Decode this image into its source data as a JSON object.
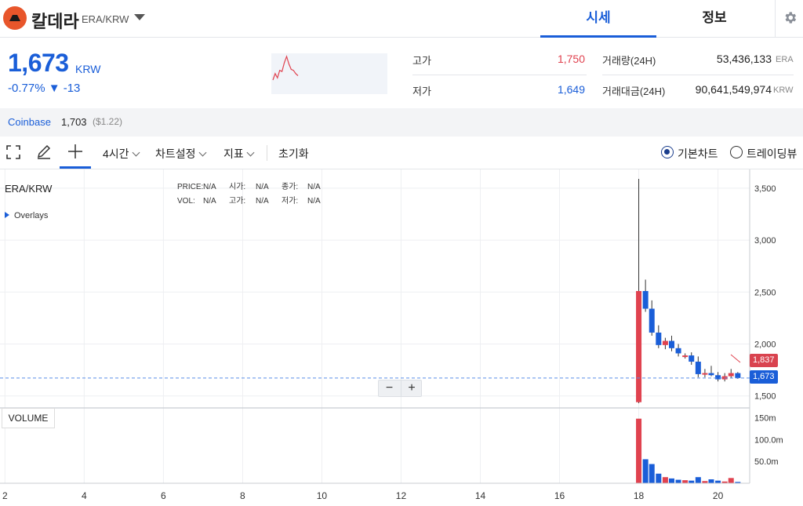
{
  "header": {
    "coin_name": "칼데라",
    "pair": "ERA/KRW",
    "tabs": [
      {
        "label": "시세",
        "active": true
      },
      {
        "label": "정보",
        "active": false
      }
    ]
  },
  "price": {
    "current": "1,673",
    "unit": "KRW",
    "change": "-0.77% ▼ -13"
  },
  "stats": {
    "high_label": "고가",
    "high_value": "1,750",
    "low_label": "저가",
    "low_value": "1,649",
    "volume_label": "거래량(24H)",
    "volume_value": "53,436,133",
    "volume_unit": "ERA",
    "amount_label": "거래대금(24H)",
    "amount_value": "90,641,549,974",
    "amount_unit": "KRW"
  },
  "exchange": {
    "name": "Coinbase",
    "price": "1,703",
    "usd": "($1.22)"
  },
  "toolbar": {
    "interval": "4시간",
    "chart_settings": "차트설정",
    "indicators": "지표",
    "reset": "초기화",
    "basic_chart": "기본차트",
    "trading_view": "트레이딩뷰"
  },
  "chart_info": {
    "pair": "ERA/KRW",
    "overlays": "Overlays",
    "price_label": "PRICE:",
    "price_val": "N/A",
    "open_label": "시가:",
    "open_val": "N/A",
    "close_label": "종가:",
    "close_val": "N/A",
    "vol_label": "VOL:",
    "vol_val": "N/A",
    "high_label": "고가:",
    "high_val": "N/A",
    "low_label": "저가:",
    "low_val": "N/A",
    "volume_panel": "VOLUME",
    "tag_high": "1,837",
    "tag_current": "1,673",
    "zoom_out": "−",
    "zoom_in": "+"
  },
  "colors": {
    "up": "#e0424f",
    "down": "#1a5ed8",
    "accent": "#1a5ed8"
  },
  "chart_data": {
    "type": "candlestick",
    "price_ticks": [
      1500,
      2000,
      2500,
      3000,
      3500
    ],
    "price_tick_labels": [
      "1,500",
      "2,000",
      "2,500",
      "3,000",
      "3,500"
    ],
    "volume_ticks": [
      "150m",
      "100.0m",
      "50.0m"
    ],
    "x_ticks": [
      2,
      4,
      6,
      8,
      10,
      12,
      14,
      16,
      18,
      20
    ],
    "x_start": 1.875,
    "x_end": 20.8,
    "price_range": [
      1430,
      3620
    ],
    "current_price": 1673,
    "candles": [
      {
        "x": 18.0,
        "o": 1440,
        "h": 3590,
        "l": 1430,
        "c": 2510,
        "v": 148
      },
      {
        "x": 18.17,
        "o": 2510,
        "h": 2620,
        "l": 2310,
        "c": 2340,
        "v": 55
      },
      {
        "x": 18.33,
        "o": 2340,
        "h": 2420,
        "l": 2080,
        "c": 2110,
        "v": 44
      },
      {
        "x": 18.5,
        "o": 2110,
        "h": 2180,
        "l": 1960,
        "c": 1990,
        "v": 22
      },
      {
        "x": 18.67,
        "o": 1990,
        "h": 2060,
        "l": 1950,
        "c": 2030,
        "v": 14
      },
      {
        "x": 18.83,
        "o": 2030,
        "h": 2080,
        "l": 1930,
        "c": 1960,
        "v": 11
      },
      {
        "x": 19.0,
        "o": 1960,
        "h": 2000,
        "l": 1880,
        "c": 1910,
        "v": 8
      },
      {
        "x": 19.17,
        "o": 1880,
        "h": 1910,
        "l": 1860,
        "c": 1890,
        "v": 7
      },
      {
        "x": 19.33,
        "o": 1890,
        "h": 1920,
        "l": 1800,
        "c": 1830,
        "v": 6
      },
      {
        "x": 19.5,
        "o": 1830,
        "h": 1880,
        "l": 1680,
        "c": 1710,
        "v": 14
      },
      {
        "x": 19.67,
        "o": 1710,
        "h": 1760,
        "l": 1680,
        "c": 1720,
        "v": 5
      },
      {
        "x": 19.83,
        "o": 1720,
        "h": 1790,
        "l": 1690,
        "c": 1700,
        "v": 9
      },
      {
        "x": 20.0,
        "o": 1700,
        "h": 1730,
        "l": 1640,
        "c": 1660,
        "v": 6
      },
      {
        "x": 20.17,
        "o": 1660,
        "h": 1720,
        "l": 1640,
        "c": 1690,
        "v": 4
      },
      {
        "x": 20.33,
        "o": 1690,
        "h": 1760,
        "l": 1670,
        "c": 1720,
        "v": 12
      },
      {
        "x": 20.5,
        "o": 1720,
        "h": 1730,
        "l": 1665,
        "c": 1673,
        "v": 3
      }
    ],
    "xlabel": "",
    "ylabel": ""
  },
  "sparkline": [
    1600,
    1660,
    1620,
    1690,
    1680,
    1760,
    1820,
    1750,
    1700,
    1690,
    1660,
    1640
  ]
}
